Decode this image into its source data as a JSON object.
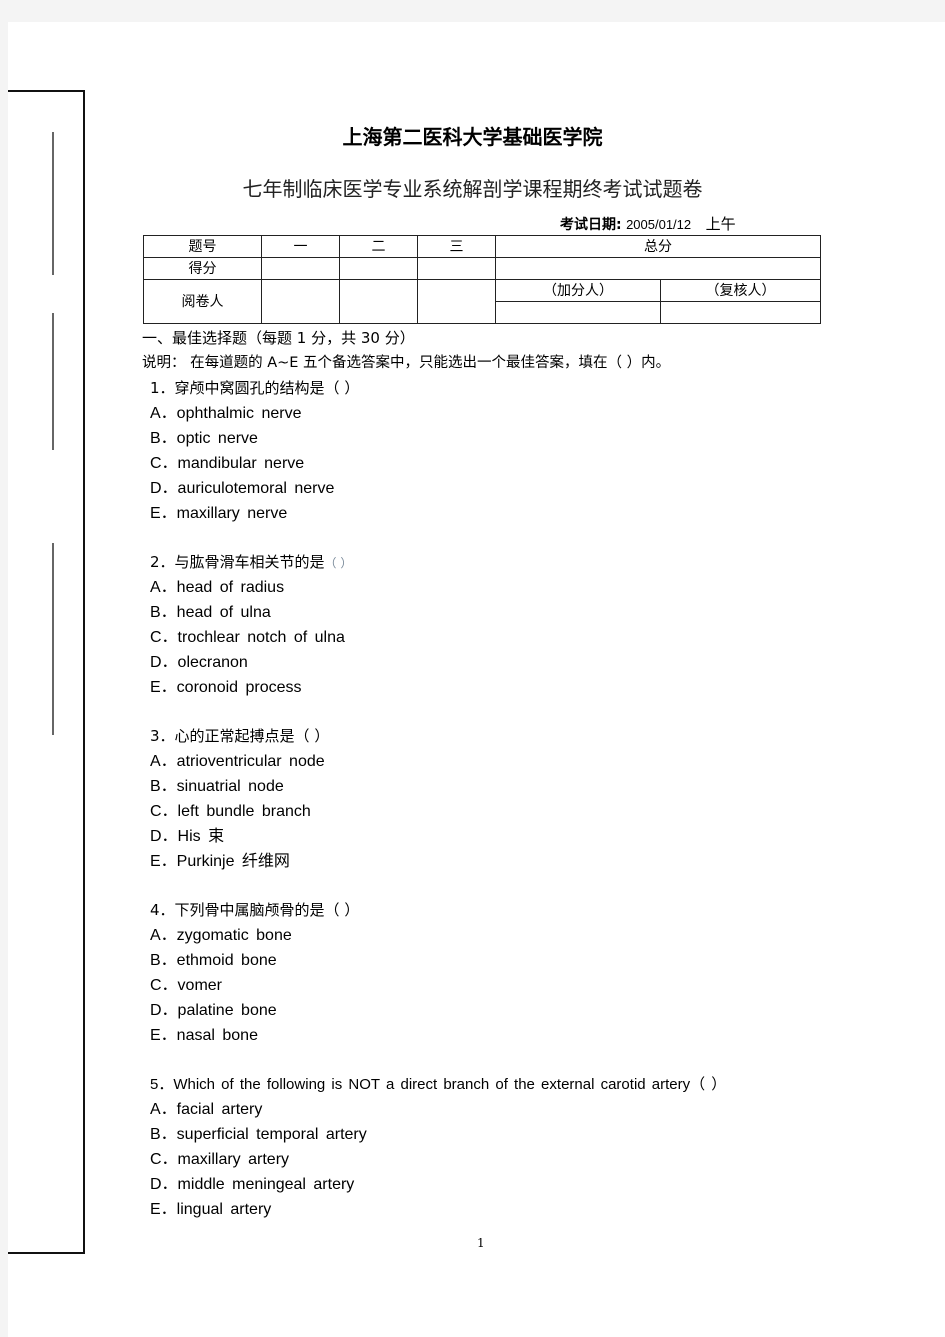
{
  "header": {
    "institution": "上海第二医科大学基础医学院",
    "exam_title": "七年制临床医学专业系统解剖学课程期终考试试题卷",
    "date_label": "考试日期:",
    "date_value": "2005/01/12",
    "session": "上午"
  },
  "score_table": {
    "row1": [
      "题号",
      "一",
      "二",
      "三",
      "总分"
    ],
    "row2_label": "得分",
    "row3_label": "阅卷人",
    "adder_label": "（加分人）",
    "reviewer_label": "（复核人）"
  },
  "section": {
    "heading": "一、最佳选择题（每题 1 分，共 30 分）",
    "instruction": "说明：  在每道题的 A~E 五个备选答案中，只能选出一个最佳答案，填在（     ）内。"
  },
  "questions": [
    {
      "stem": "1．穿颅中窝圆孔的结构是（     ）",
      "options": [
        "A．ophthalmic  nerve",
        "B．optic  nerve",
        "C．mandibular  nerve",
        "D．auriculotemoral  nerve",
        "E．maxillary  nerve"
      ]
    },
    {
      "stem": "2．与肱骨滑车相关节的是",
      "stem_paren": "（       ）",
      "options": [
        "A．head  of  radius",
        "B．head  of  ulna",
        "C．trochlear  notch  of  ulna",
        "D．olecranon",
        "E．coronoid  process"
      ]
    },
    {
      "stem": "3．心的正常起搏点是（     ）",
      "options": [
        "A．atrioventricular  node",
        "B．sinuatrial  node",
        "C．left  bundle  branch",
        "D．His 束",
        "E．Purkinje  纤维网"
      ]
    },
    {
      "stem": "4．下列骨中属脑颅骨的是（     ）",
      "options": [
        "A．zygomatic  bone",
        "B．ethmoid  bone",
        "C．vomer",
        "D．palatine  bone",
        "E．nasal  bone"
      ]
    },
    {
      "stem": "5．Which  of  the  following  is  NOT  a  direct  branch  of  the  external  carotid  artery（   ）",
      "options": [
        "A．facial  artery",
        "B．superficial  temporal  artery",
        "C．maxillary  artery",
        "D．middle  meningeal  artery",
        "E．lingual  artery"
      ]
    }
  ],
  "footer": {
    "page_number": "1"
  }
}
